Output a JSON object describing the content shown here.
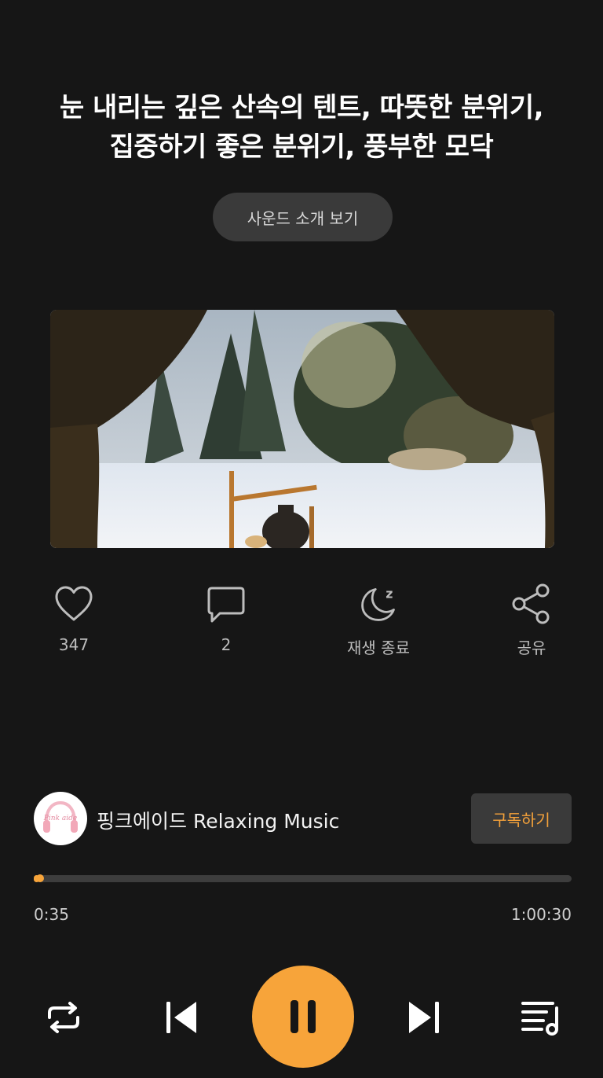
{
  "title": {
    "line1": "눈 내리는 깊은 산속의 텐트, 따뜻한 분위기,",
    "line2": "집중하기 좋은 분위기, 풍부한 모닥"
  },
  "intro_button": "사운드 소개 보기",
  "actions": {
    "like_count": "347",
    "comment_count": "2",
    "sleep_timer_label": "재생 종료",
    "share_label": "공유"
  },
  "channel": {
    "name": "핑크에이드 Relaxing Music",
    "avatar_text": "Pink aide",
    "subscribe_label": "구독하기"
  },
  "player": {
    "current_time": "0:35",
    "total_time": "1:00:30",
    "progress": 0.0097
  },
  "colors": {
    "accent": "#f7a43a",
    "background": "#161616",
    "button_bg": "#3a3a3a"
  },
  "icons": {
    "like": "heart-icon",
    "comment": "comment-icon",
    "sleep": "moon-icon",
    "share": "share-icon",
    "repeat": "repeat-icon",
    "previous": "skip-previous-icon",
    "pause": "pause-icon",
    "next": "skip-next-icon",
    "playlist": "playlist-icon"
  }
}
